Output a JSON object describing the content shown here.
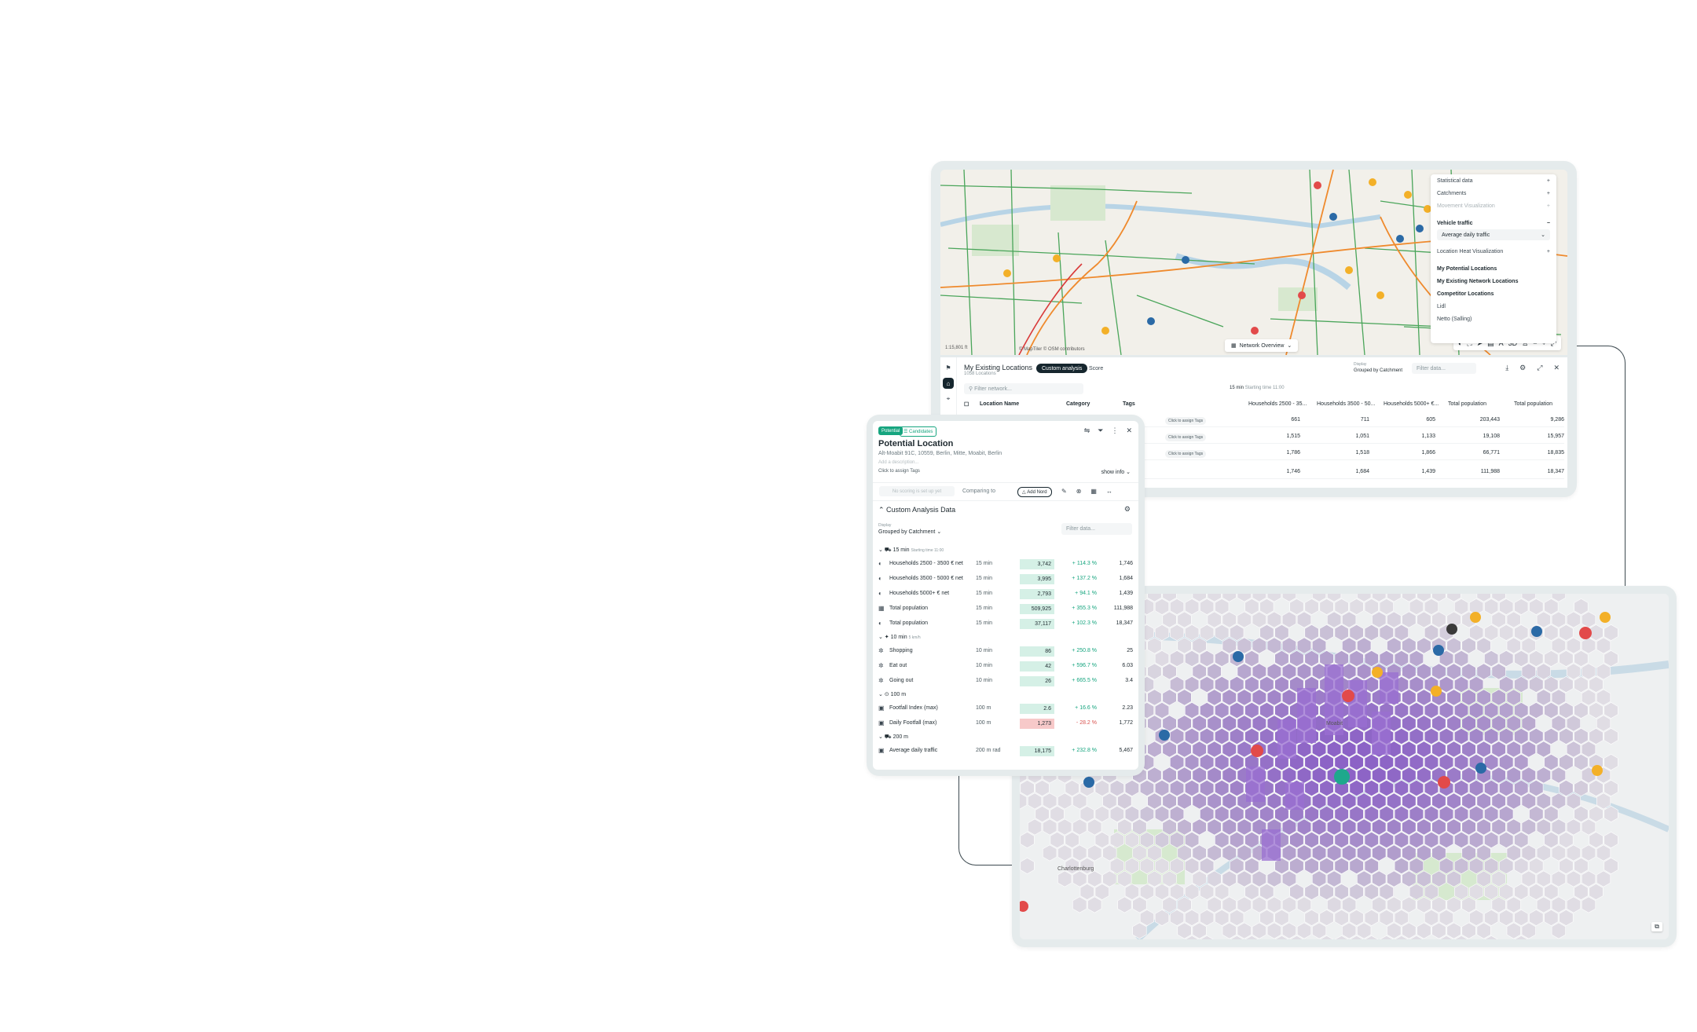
{
  "top_window": {
    "layers": {
      "items": [
        "Statistical data",
        "Catchments",
        "Movement Visualization"
      ],
      "vehicle_traffic": "Vehicle traffic",
      "vehicle_select": "Average daily traffic",
      "heat_viz": "Location Heat Visualization",
      "groups": [
        "My Potential Locations",
        "My Existing Network Locations",
        "Competitor Locations"
      ],
      "competitors": [
        "Lidl",
        "Netto (Salling)"
      ]
    },
    "network_button": "Network Overview",
    "scale": "1:15,801 ft",
    "attribution": "© MapTiler  © OSM contributors",
    "table": {
      "title": "My Existing Locations",
      "subtitle": "1058 Locations",
      "tabs": [
        "Custom analysis",
        "Score"
      ],
      "display_label": "Display",
      "display_value": "Grouped by Catchment",
      "filter_placeholder": "Filter data...",
      "filter_network": "Filter network...",
      "catchment_label": "15 min",
      "catchment_note": "Starting time 11:00",
      "headers": [
        "Location Name",
        "Category",
        "Tags",
        "Households 2500 - 35...",
        "Households 3500 - 50...",
        "Households 5000+ €...",
        "Total population",
        "Total population"
      ],
      "tag_button": "Click to assign Tags",
      "rows": [
        [
          "661",
          "711",
          "605",
          "203,443",
          "9,286"
        ],
        [
          "1,515",
          "1,051",
          "1,133",
          "19,108",
          "15,957"
        ],
        [
          "1,786",
          "1,518",
          "1,866",
          "66,771",
          "18,835"
        ],
        [
          "1,746",
          "1,684",
          "1,439",
          "111,988",
          "18,347"
        ]
      ]
    }
  },
  "panel": {
    "tags": [
      "Potential",
      "Candidates"
    ],
    "title": "Potential Location",
    "address": "Alt-Moabit 91C, 10559, Berlin, Mitte, Moabit, Berlin",
    "description_placeholder": "Add a description...",
    "assign_tags": "Click to assign Tags",
    "show_info": "show info",
    "compare_placeholder": "No scoring is set up yet",
    "compare_label": "Comparing to",
    "compare_add": "Add Nord",
    "section_title": "Custom Analysis Data",
    "display_label": "Display",
    "display_value": "Grouped by Catchment",
    "filter_placeholder": "Filter data...",
    "groups": [
      {
        "label": "15 min",
        "note": "Starting time 11:00"
      },
      {
        "label": "10 min",
        "note": "5 km/h"
      },
      {
        "label": "100 m",
        "note": ""
      },
      {
        "label": "200 m",
        "note": ""
      }
    ],
    "rows": [
      {
        "name": "Households 2500 - 3500 € net",
        "mode": "15 min",
        "value": "3,742",
        "pct": "+ 114.3 %",
        "cmp": "1,746",
        "dir": "pos",
        "icon": "◐"
      },
      {
        "name": "Households 3500 - 5000 € net",
        "mode": "15 min",
        "value": "3,995",
        "pct": "+ 137.2 %",
        "cmp": "1,684",
        "dir": "pos",
        "icon": "◐"
      },
      {
        "name": "Households 5000+ € net",
        "mode": "15 min",
        "value": "2,793",
        "pct": "+ 94.1 %",
        "cmp": "1,439",
        "dir": "pos",
        "icon": "◐"
      },
      {
        "name": "Total population",
        "mode": "15 min",
        "value": "509,925",
        "pct": "+ 355.3 %",
        "cmp": "111,988",
        "dir": "pos",
        "icon": "▦"
      },
      {
        "name": "Total population",
        "mode": "15 min",
        "value": "37,117",
        "pct": "+ 102.3 %",
        "cmp": "18,347",
        "dir": "pos",
        "icon": "◐"
      },
      {
        "name": "Shopping",
        "mode": "10 min",
        "value": "86",
        "pct": "+ 250.8 %",
        "cmp": "25",
        "dir": "pos",
        "icon": "✲"
      },
      {
        "name": "Eat out",
        "mode": "10 min",
        "value": "42",
        "pct": "+ 596.7 %",
        "cmp": "6.03",
        "dir": "pos",
        "icon": "✲"
      },
      {
        "name": "Going out",
        "mode": "10 min",
        "value": "26",
        "pct": "+ 665.5 %",
        "cmp": "3.4",
        "dir": "pos",
        "icon": "✲"
      },
      {
        "name": "Footfall Index (max)",
        "mode": "100 m",
        "value": "2.6",
        "pct": "+ 16.6 %",
        "cmp": "2.23",
        "dir": "pos",
        "icon": "▣"
      },
      {
        "name": "Daily Footfall (max)",
        "mode": "100 m",
        "value": "1,273",
        "pct": "- 28.2 %",
        "cmp": "1,772",
        "dir": "neg",
        "icon": "▣"
      },
      {
        "name": "Average daily traffic",
        "mode": "200 m rad",
        "value": "18,175",
        "pct": "+ 232.8 %",
        "cmp": "5,467",
        "dir": "pos",
        "icon": "▣"
      }
    ],
    "colors": {
      "accent": "#16a57f",
      "pos_bg": "#d5f0e6",
      "neg_bg": "#f7c9c9"
    }
  },
  "map_bottom": {
    "district_labels": [
      "Moabit",
      "Charlottenburg"
    ]
  }
}
